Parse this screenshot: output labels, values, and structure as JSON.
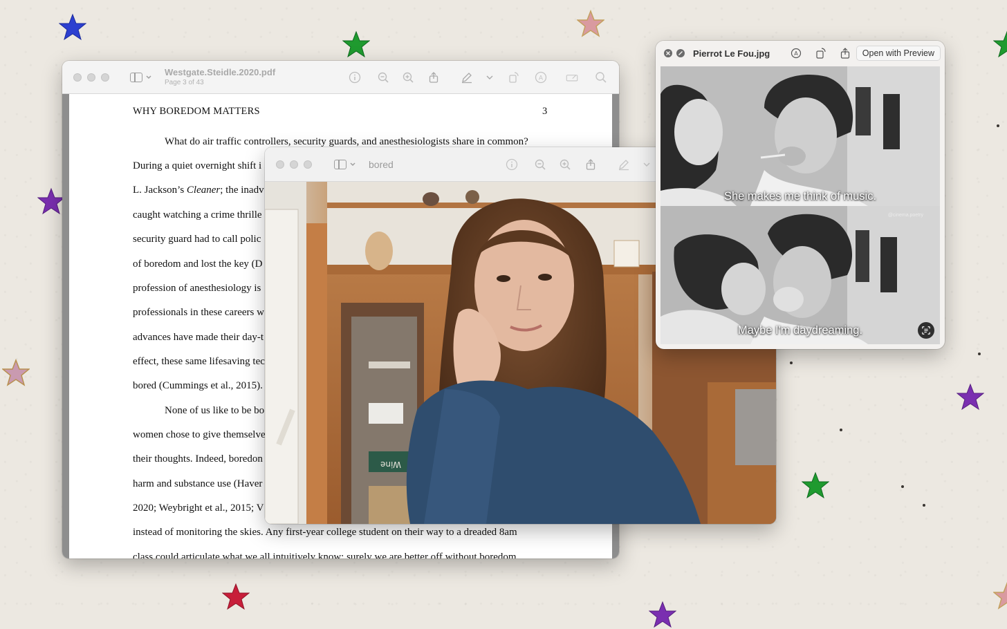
{
  "pdf_window": {
    "file_name": "Westgate.Steidle.2020.pdf",
    "page_indicator": "Page 3 of 43",
    "page": {
      "running_head": "WHY BOREDOM MATTERS",
      "page_number": "3",
      "lines": [
        "What do air traffic controllers, security guards, and anesthesiologists share in common?",
        "During a quiet overnight shift i",
        "L. Jackson’s Cleaner; the inadv",
        "caught watching a crime thrille",
        "security guard had to call polic",
        "of boredom and lost the key (D",
        "profession of anesthesiology is",
        "professionals in these careers w",
        "advances have made their day-t",
        "effect, these same lifesaving tec",
        "bored (Cummings et al., 2015).",
        "None of us like to be bo",
        "women chose to give themselve",
        "their thoughts. Indeed, boredon",
        "harm and substance use (Haver",
        "2020; Weybright et al., 2015; V",
        "instead of monitoring the skies. Any first-year college student on their way to a dreaded 8am",
        "class could articulate what we all intuitively know: surely we are better off without boredom."
      ],
      "italic_word": "Cleaner"
    }
  },
  "video_window": {
    "title": "bored",
    "box_label": "Wine"
  },
  "pierrot_window": {
    "file_name": "Pierrot Le Fou.jpg",
    "open_button": "Open with Preview",
    "caption_top": "She makes me think of music.",
    "caption_bottom": "Maybe I'm daydreaming.",
    "watermark": "@cinema.poetry"
  },
  "colors": {
    "desktop": "#ece8e1",
    "star_blue": "#2c3fd0",
    "star_green": "#1f9a2f",
    "star_purple": "#7a2fb0",
    "star_red": "#c81e3a",
    "star_opal": "#d99aa0"
  }
}
